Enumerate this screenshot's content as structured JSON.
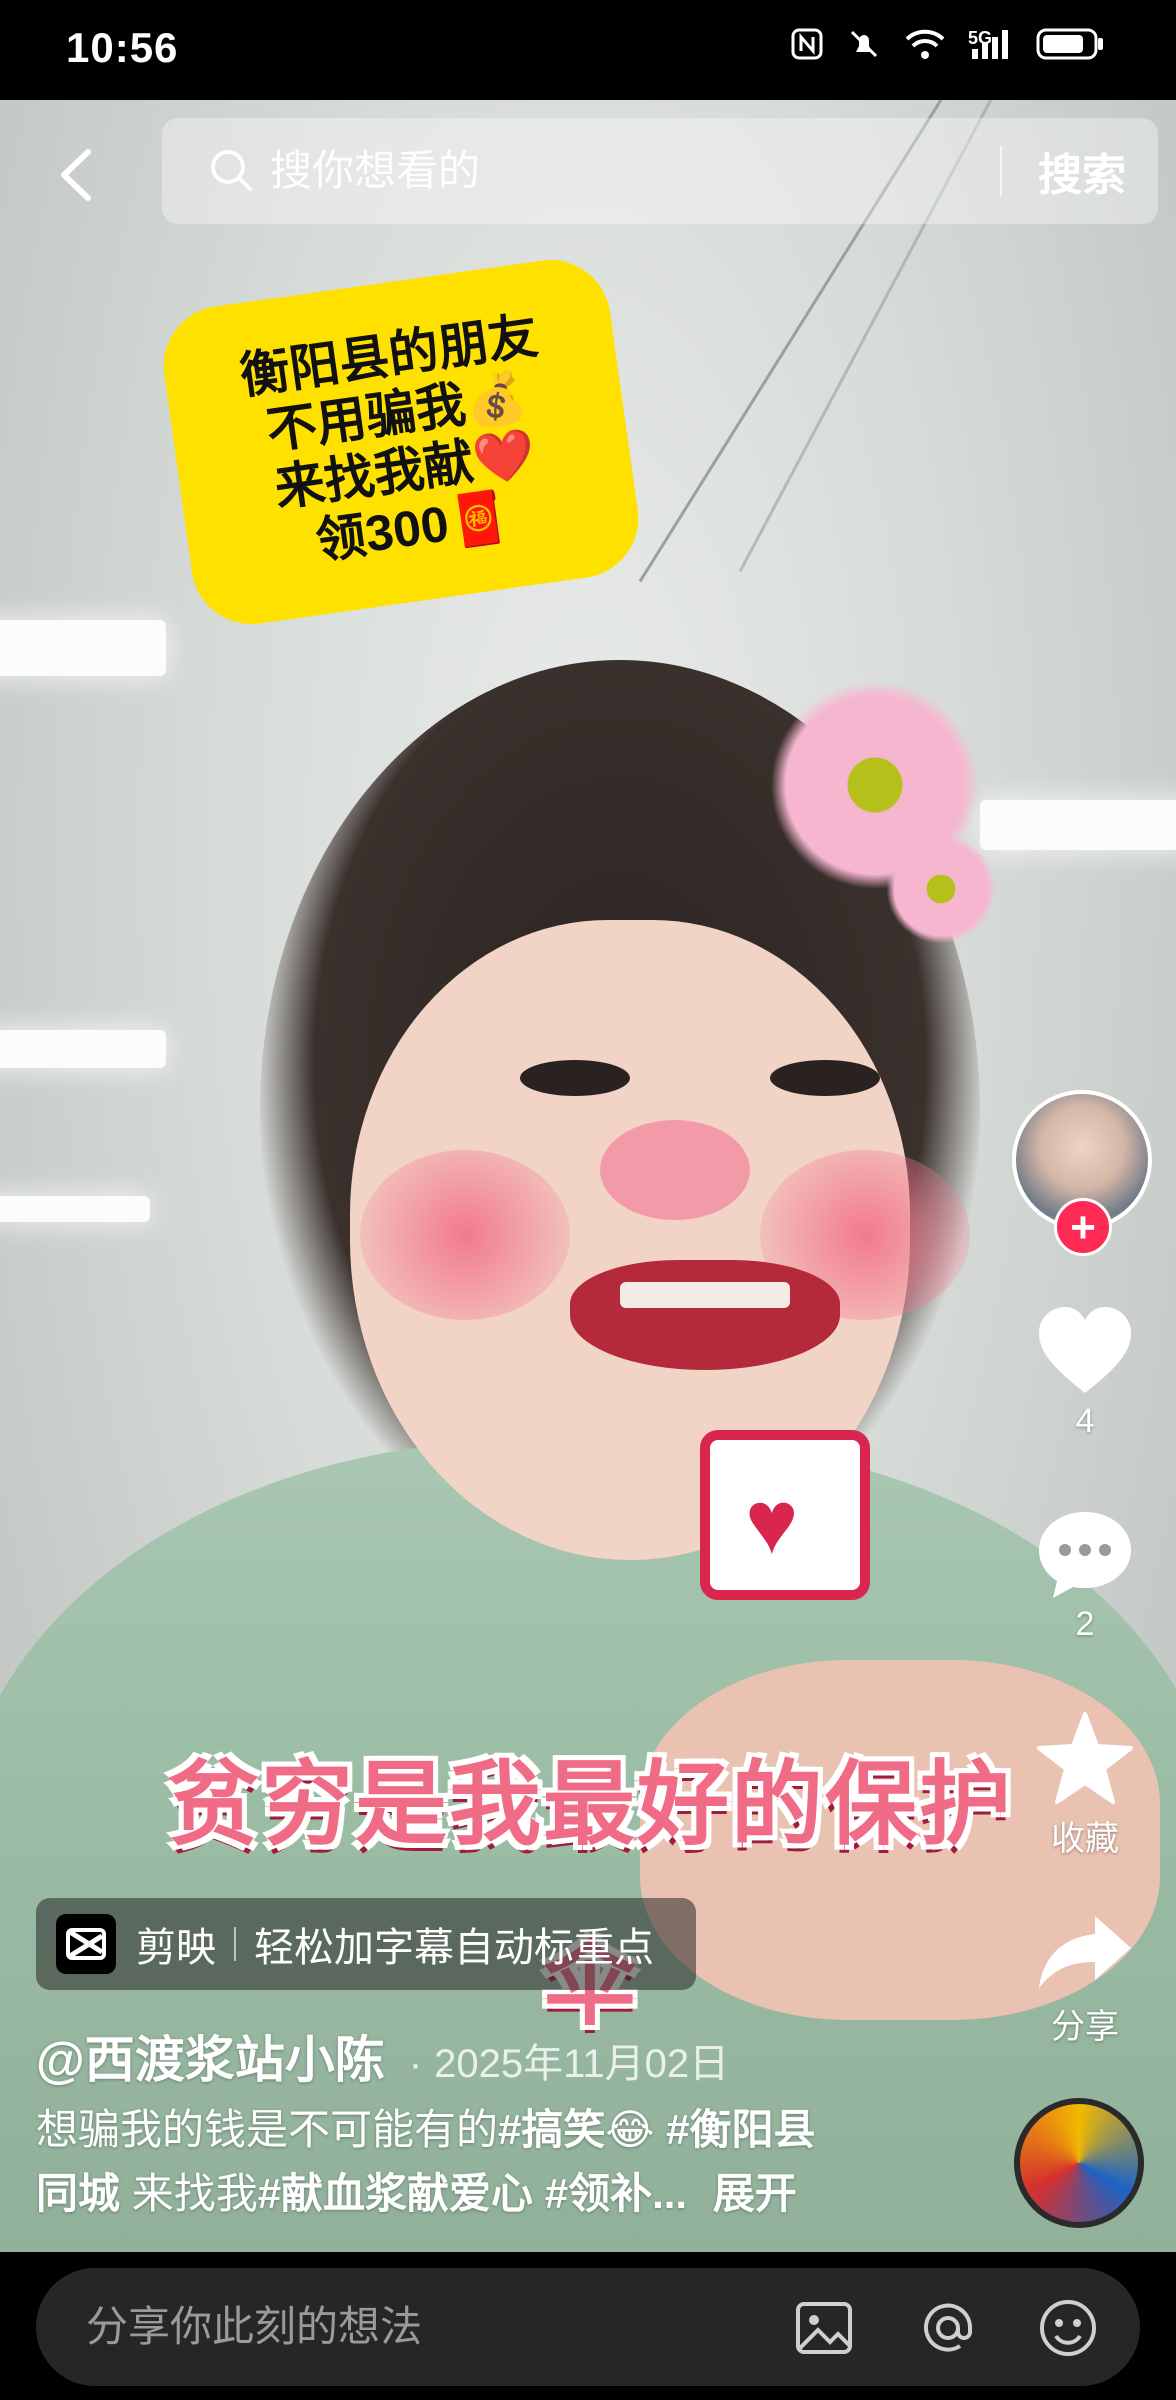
{
  "status_bar": {
    "time": "10:56",
    "icons": [
      "nfc-icon",
      "mute-icon",
      "wifi-icon",
      "signal-5g-icon",
      "battery-icon"
    ],
    "network_label": "5G"
  },
  "top_bar": {
    "search_placeholder": "搜你想看的",
    "search_button": "搜索"
  },
  "overlay": {
    "sticker_lines": [
      "衡阳县的朋友",
      "不用骗我💰",
      "来找我献❤️",
      "领300🧧"
    ],
    "caption_line1": "贫穷是我最好的保护",
    "caption_line2": "伞"
  },
  "right_rail": {
    "follow": "+",
    "like_count": "4",
    "comment_count": "2",
    "favorite_label": "收藏",
    "share_label": "分享"
  },
  "video_info": {
    "app_tag_name": "剪映",
    "app_tag_desc": "轻松加字幕自动标重点",
    "author": "@西渡浆站小陈",
    "date_sep": "·",
    "date": "2025年11月02日",
    "desc_line1_text": "想骗我的钱是不可能有的",
    "desc_tag1": "#搞笑😂",
    "desc_tag2": "#衡阳县",
    "desc_line2_text1": "同城",
    "desc_line2_text2": "来找我",
    "desc_tag3": "#献血浆献爱心",
    "desc_tag4": "#领补...",
    "expand": "展开"
  },
  "bottom_bar": {
    "comment_placeholder": "分享你此刻的想法"
  },
  "colors": {
    "like_red": "#fe2c55",
    "sticker_yellow": "#ffe100",
    "caption_pink": "#f06c86"
  }
}
